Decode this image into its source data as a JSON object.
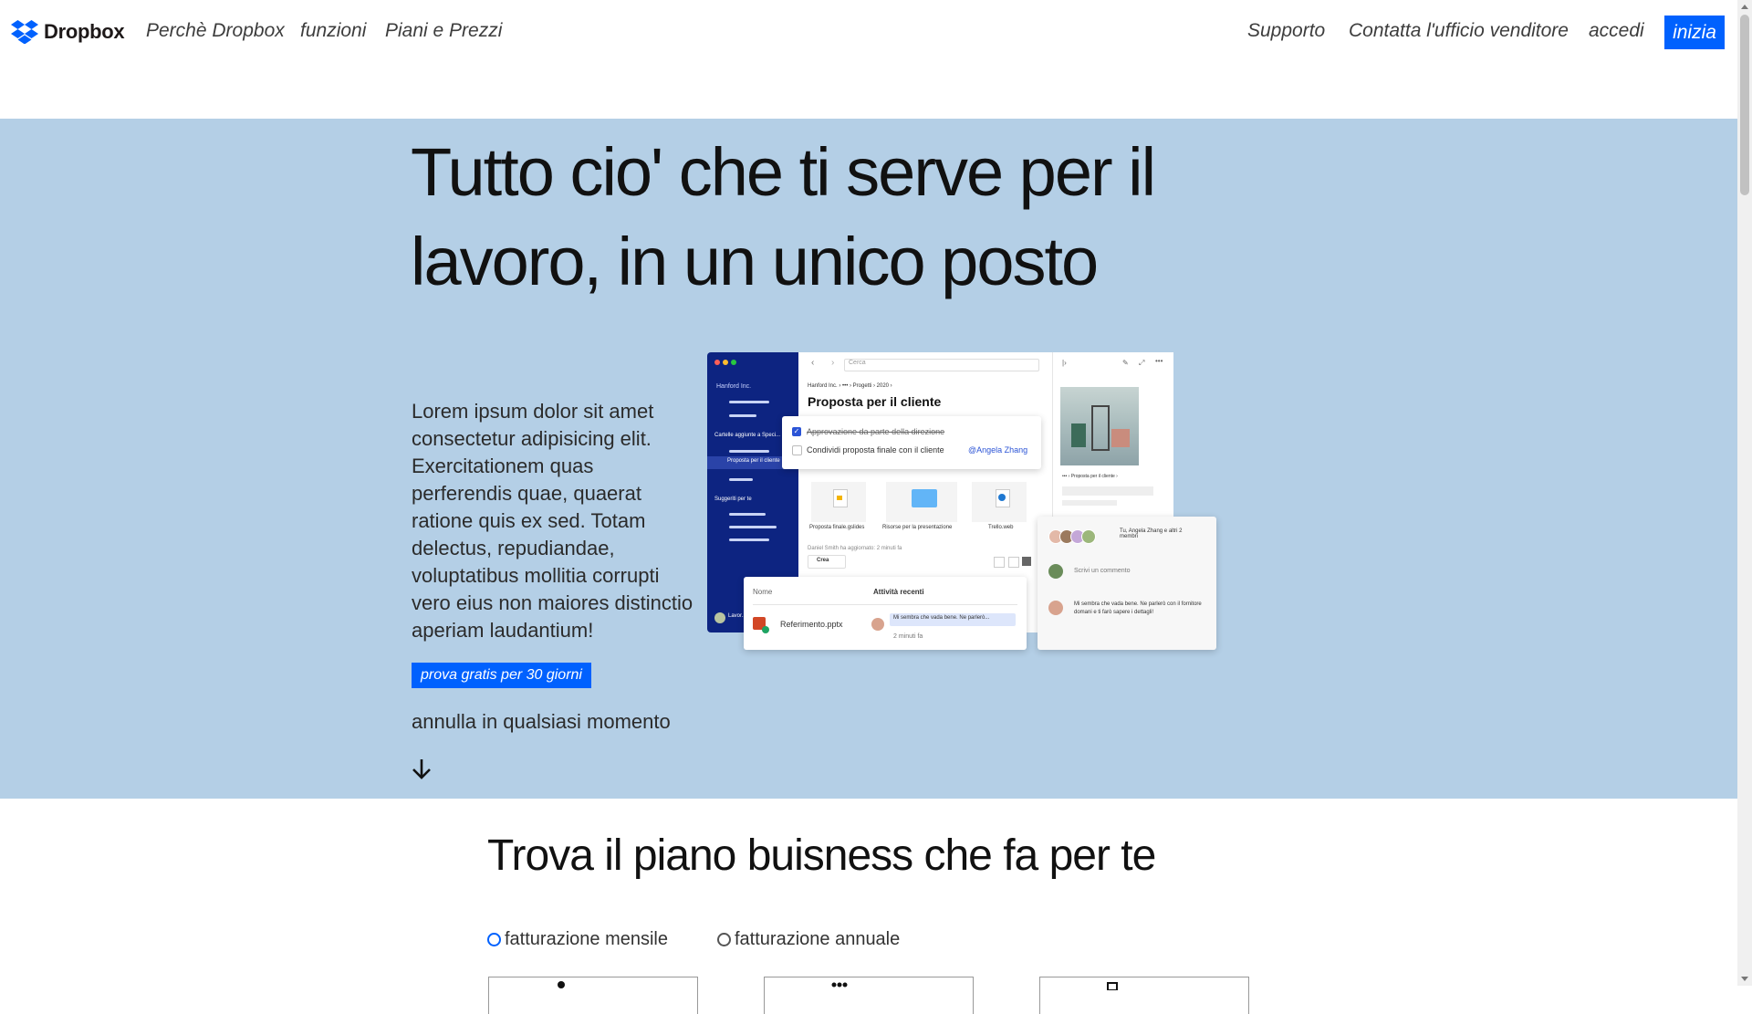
{
  "nav": {
    "brand": "Dropbox",
    "links_left": [
      "Perchè Dropbox",
      "funzioni",
      "Piani e Prezzi"
    ],
    "links_right": [
      "Supporto",
      "Contatta l'ufficio venditore",
      "accedi"
    ],
    "cta": "inizia"
  },
  "hero": {
    "title": "Tutto cio' che ti serve per il lavoro, in un unico posto",
    "body": "Lorem ipsum dolor sit amet consectetur adipisicing elit. Exercitationem quas perferendis quae, quaerat ratione quis ex sed. Totam delectus, repudiandae, voluptatibus mollitia corrupti vero eius non maiores distinctio aperiam laudantium!",
    "trial_button": "prova gratis per 30 giorni",
    "cancel_note": "annulla in qualsiasi momento"
  },
  "mockup": {
    "search_placeholder": "Cerca",
    "org": "Hanford Inc.",
    "sidebar_section": "Cartelle aggiunte a Speci...",
    "sidebar_item": "Proposta per il cliente",
    "sidebar_suggested": "Suggeriti per te",
    "breadcrumb": "Hanford Inc.  ›  •••  ›  Progetti  ›  2020  ›",
    "folder_title": "Proposta per il cliente",
    "tasks": [
      "Approvazione da parte della direzione",
      "Condividi proposta finale con il cliente"
    ],
    "mention": "@Angela Zhang",
    "files": [
      "Proposta finale.gslides",
      "Risorse per la presentazione",
      "Trello.web"
    ],
    "activity_note": "Daniel Smith ha aggiornato: 2 minuti fa",
    "create_button": "Crea",
    "list_header_name": "Nome",
    "list_header_activity": "Attività recenti",
    "file_row": "Referimento.pptx",
    "file_comment": "Mi sembra che vada bene. Ne parlerò...",
    "file_time": "2 minuti fa",
    "right_breadcrumb": "•••  ›  Proposta per il cliente  ›",
    "members": "Tu, Angela Zhang e altri 2 membri",
    "comment_placeholder": "Scrivi un commento",
    "comment_text": "Mi sembra che vada bene. Ne parlerò con il fornitore domani e ti farò sapere i dettagli!",
    "footer_user": "Lavor..."
  },
  "pricing": {
    "title": "Trova il piano buisness che fa per te",
    "billing_options": [
      "fatturazione mensile",
      "fatturazione annuale"
    ],
    "selected_billing": "fatturazione mensile"
  },
  "colors": {
    "accent": "#0061fe",
    "hero_bg": "#b4cfe6",
    "sidebar_dark": "#0d2481"
  }
}
